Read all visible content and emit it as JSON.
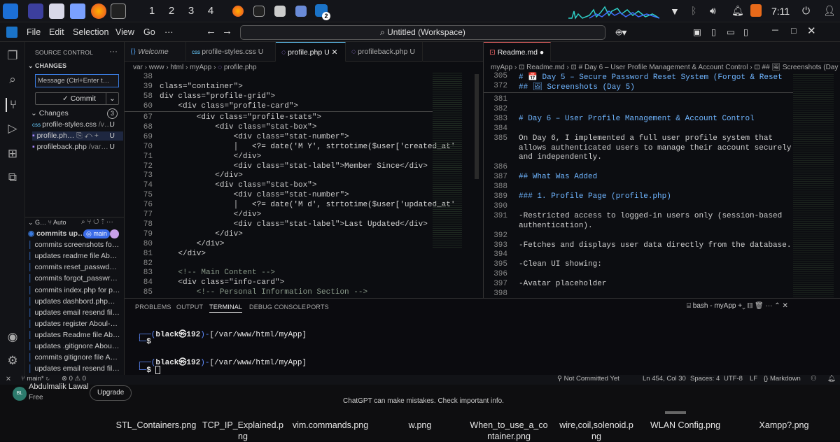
{
  "taskbar": {
    "workspaces": [
      "1",
      "2",
      "3",
      "4"
    ],
    "vscode_badge": "2",
    "clock": "7:11"
  },
  "titlebar": {
    "menus": [
      "File",
      "Edit",
      "Selection",
      "View",
      "Go",
      "···"
    ],
    "command_center": "Untitled (Workspace)"
  },
  "sidebar": {
    "title": "SOURCE CONTROL",
    "changes_header": "CHANGES",
    "message_placeholder": "Message (Ctrl+Enter t…",
    "commit_label": "✓ Commit",
    "changes_label": "Changes",
    "changes_count": "3",
    "files": [
      {
        "name": "profile-styles.css",
        "path": "/v…",
        "status": "U"
      },
      {
        "name": "profile.ph…",
        "path": "",
        "status": "U"
      },
      {
        "name": "profileback.php",
        "path": "/var…",
        "status": "U"
      }
    ],
    "graph_header": "G…",
    "graph_mode": "Auto",
    "commits": [
      "commits up…",
      "commits screenshots fo…",
      "updates readme file Ab…",
      "commits reset_passwd…",
      "commits forgot_passwr…",
      "commits index.php for p…",
      "updates dashbord.php…",
      "updates email resend fil…",
      "updates register Aboul-…",
      "updates Readme file Ab…",
      "updates .gitignore Abou…",
      "commits gitignore file A…",
      "updates email resend fil…"
    ],
    "branch_badge": "main"
  },
  "editor": {
    "tabs": [
      {
        "label": "Welcome"
      },
      {
        "label": "profile-styles.css",
        "status": "U"
      },
      {
        "label": "profile.php",
        "status": "U"
      },
      {
        "label": "profileback.php",
        "status": "U"
      }
    ],
    "breadcrumb": "var › www › html › myApp › ",
    "breadcrumb_file": "profile.php",
    "sticky": [
      {
        "n": "38",
        "t": ""
      },
      {
        "n": "39",
        "t": "class=\"container\">"
      },
      {
        "n": "58",
        "t": "div class=\"profile-grid\">"
      },
      {
        "n": "60",
        "t": "    <div class=\"profile-card\">"
      }
    ],
    "lines": [
      {
        "n": "67",
        "t": "        <div class=\"profile-stats\">"
      },
      {
        "n": "68",
        "t": "            <div class=\"stat-box\">"
      },
      {
        "n": "69",
        "t": "                <div class=\"stat-number\">"
      },
      {
        "n": "70",
        "t": "                │   <?= date('M Y', strtotime($user['created_at'"
      },
      {
        "n": "71",
        "t": "                </div>"
      },
      {
        "n": "72",
        "t": "                <div class=\"stat-label\">Member Since</div>"
      },
      {
        "n": "73",
        "t": "            </div>"
      },
      {
        "n": "74",
        "t": "            <div class=\"stat-box\">"
      },
      {
        "n": "75",
        "t": "                <div class=\"stat-number\">"
      },
      {
        "n": "76",
        "t": "                │   <?= date('M d', strtotime($user['updated_at'"
      },
      {
        "n": "77",
        "t": "                </div>"
      },
      {
        "n": "78",
        "t": "                <div class=\"stat-label\">Last Updated</div>"
      },
      {
        "n": "79",
        "t": "            </div>"
      },
      {
        "n": "80",
        "t": "        </div>"
      },
      {
        "n": "81",
        "t": "    </div>"
      },
      {
        "n": "82",
        "t": ""
      },
      {
        "n": "83",
        "t": "    <!-- Main Content -->"
      },
      {
        "n": "84",
        "t": "    <div class=\"info-card\">"
      },
      {
        "n": "85",
        "t": "        <!-- Personal Information Section -->"
      }
    ]
  },
  "readme": {
    "tab": "Readme.md",
    "breadcrumb": "myApp › ⊡ Readme.md › ⊡ # Day 6 – User Profile Management & Account Control › ⊡ ## 🖼 Screenshots (Day 6)",
    "sticky": [
      {
        "n": "305",
        "t": "# 📅 Day 5 – Secure Password Reset System (Forgot & Reset"
      },
      {
        "n": "372",
        "t": "## 🖼 Screenshots (Day 5)"
      }
    ],
    "lines": [
      {
        "n": "381",
        "t": ""
      },
      {
        "n": "382",
        "t": ""
      },
      {
        "n": "383",
        "t": "# Day 6 – User Profile Management & Account Control"
      },
      {
        "n": "384",
        "t": ""
      },
      {
        "n": "385",
        "t": "On Day 6, I implemented a full user profile system that"
      },
      {
        "n": "",
        "t": "allows authenticated users to manage their account securely"
      },
      {
        "n": "",
        "t": "and independently."
      },
      {
        "n": "386",
        "t": ""
      },
      {
        "n": "387",
        "t": "## What Was Added"
      },
      {
        "n": "388",
        "t": ""
      },
      {
        "n": "389",
        "t": "### 1. Profile Page (profile.php)"
      },
      {
        "n": "390",
        "t": ""
      },
      {
        "n": "391",
        "t": "-Restricted access to logged-in users only (session-based"
      },
      {
        "n": "",
        "t": "authentication)."
      },
      {
        "n": "392",
        "t": ""
      },
      {
        "n": "393",
        "t": "-Fetches and displays user data directly from the database."
      },
      {
        "n": "394",
        "t": ""
      },
      {
        "n": "395",
        "t": "-Clean UI showing:"
      },
      {
        "n": "396",
        "t": ""
      },
      {
        "n": "397",
        "t": "-Avatar placeholder"
      },
      {
        "n": "398",
        "t": ""
      }
    ]
  },
  "panel": {
    "tabs": [
      "PROBLEMS",
      "OUTPUT",
      "TERMINAL",
      "DEBUG CONSOLE",
      "PORTS"
    ],
    "shell": "bash - myApp",
    "prompt_user": "black㉿192",
    "prompt_path": "[/var/www/html/myApp]",
    "prompt_symbol": "$"
  },
  "status": {
    "branch": "main*",
    "errors": "⊗ 0 ⚠ 0",
    "not_committed": "Not Committed Yet",
    "position": "Ln 454, Col 30",
    "spaces": "Spaces: 4",
    "encoding": "UTF-8",
    "eol": "LF",
    "language": "{} Markdown"
  },
  "chatgpt": {
    "user_initials": "BL",
    "user_name": "Abdulmalik Lawal",
    "plan": "Free",
    "upgrade": "Upgrade",
    "disclaimer": "ChatGPT can make mistakes. Check important info."
  },
  "files": [
    "STL_Containers.png",
    "TCP_IP_Explained.p\nng",
    "vim.commands.png",
    "w.png",
    "When_to_use_a_co\nntainer.png",
    "wire,coil,solenoid.p\nng",
    "WLAN Config.png",
    "Xampp?.png"
  ]
}
